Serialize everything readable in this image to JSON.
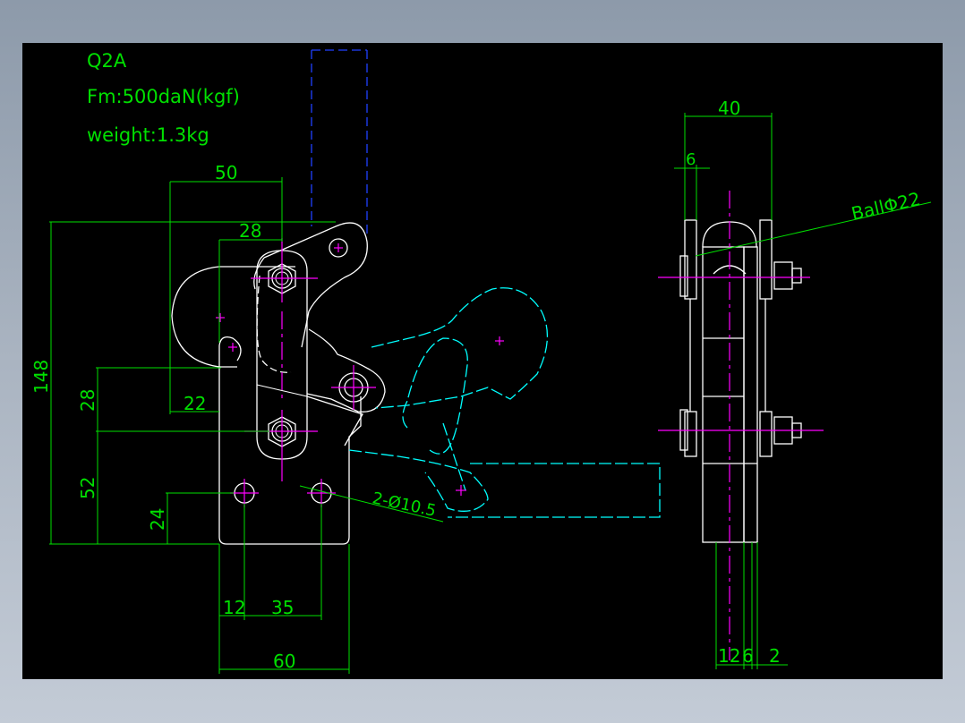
{
  "title": {
    "model": "Q2A",
    "force": "Fm:500daN(kgf)",
    "weight": "weight:1.3kg"
  },
  "front_view_dims": {
    "d50": "50",
    "d28_top": "28",
    "d148": "148",
    "d28_left": "28",
    "d22": "22",
    "d52": "52",
    "d24": "24",
    "d12": "12",
    "d35": "35",
    "d60": "60",
    "holes": "2-Ø10.5"
  },
  "side_view_dims": {
    "d40": "40",
    "d6_top": "6",
    "ball": "BallΦ22",
    "d12": "12",
    "d6": "6",
    "d2": "2"
  },
  "colors": {
    "outline": "#ffffff",
    "dimension": "#00e000",
    "center": "#ff00ff",
    "phantom": "#00ffff",
    "hidden": "#2040ff"
  }
}
